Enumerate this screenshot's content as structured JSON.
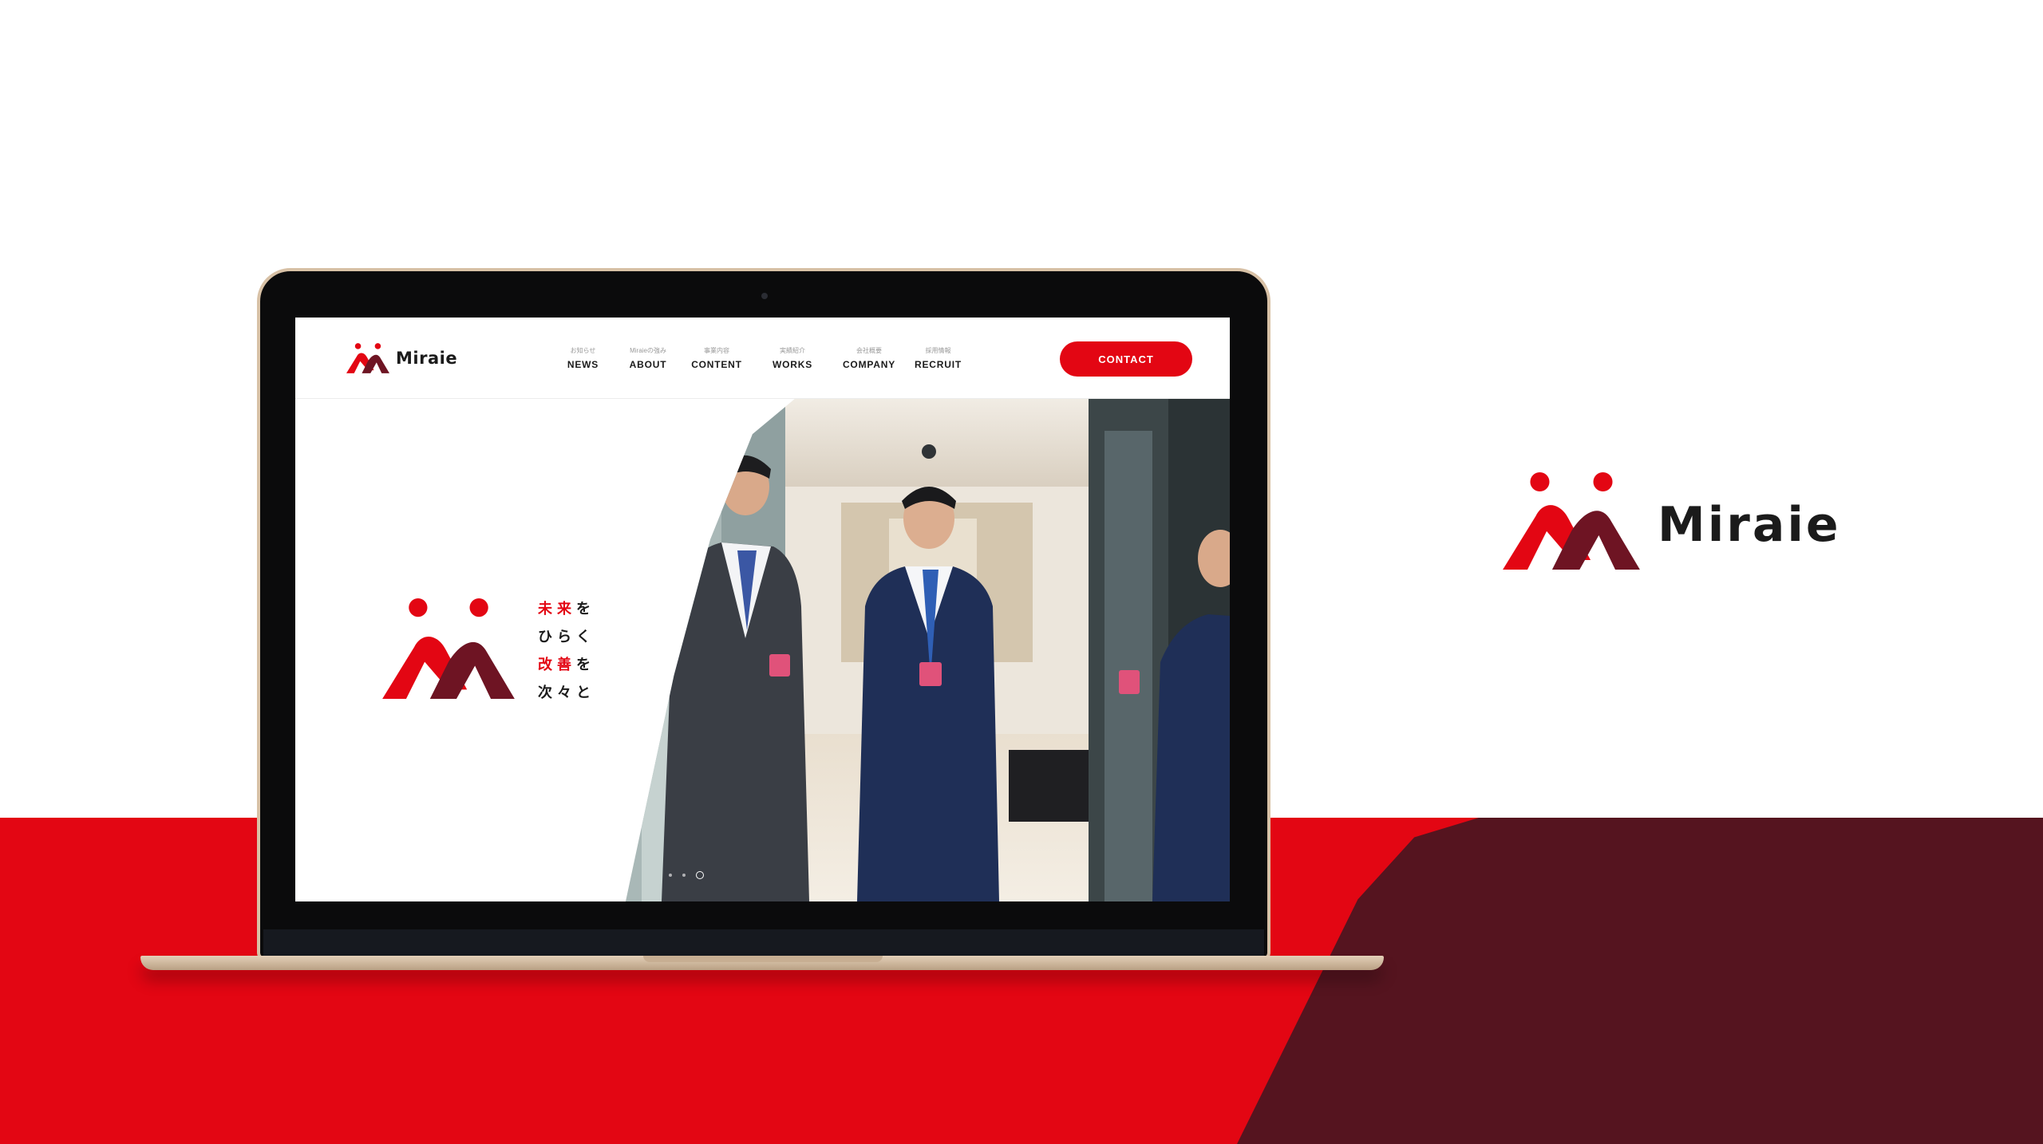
{
  "brand": {
    "name": "Miraie",
    "colors": {
      "red": "#e30613",
      "maroon": "#6e1423",
      "dark_bg": "#55141f"
    }
  },
  "site": {
    "logo_text": "Miraie",
    "nav": [
      {
        "sub": "お知らせ",
        "label": "NEWS"
      },
      {
        "sub": "Miraieの強み",
        "label": "ABOUT"
      },
      {
        "sub": "事業内容",
        "label": "CONTENT"
      },
      {
        "sub": "実績紹介",
        "label": "WORKS"
      },
      {
        "sub": "会社概要",
        "label": "COMPANY"
      },
      {
        "sub": "採用情報",
        "label": "RECRUIT"
      }
    ],
    "contact_label": "CONTACT",
    "hero": {
      "tagline": [
        {
          "red": "未来",
          "black": "を"
        },
        {
          "red": "",
          "black": "ひらく"
        },
        {
          "red": "改善",
          "black": "を"
        },
        {
          "red": "",
          "black": "次々と"
        }
      ],
      "slider": {
        "count": 3,
        "active": 3
      }
    }
  }
}
